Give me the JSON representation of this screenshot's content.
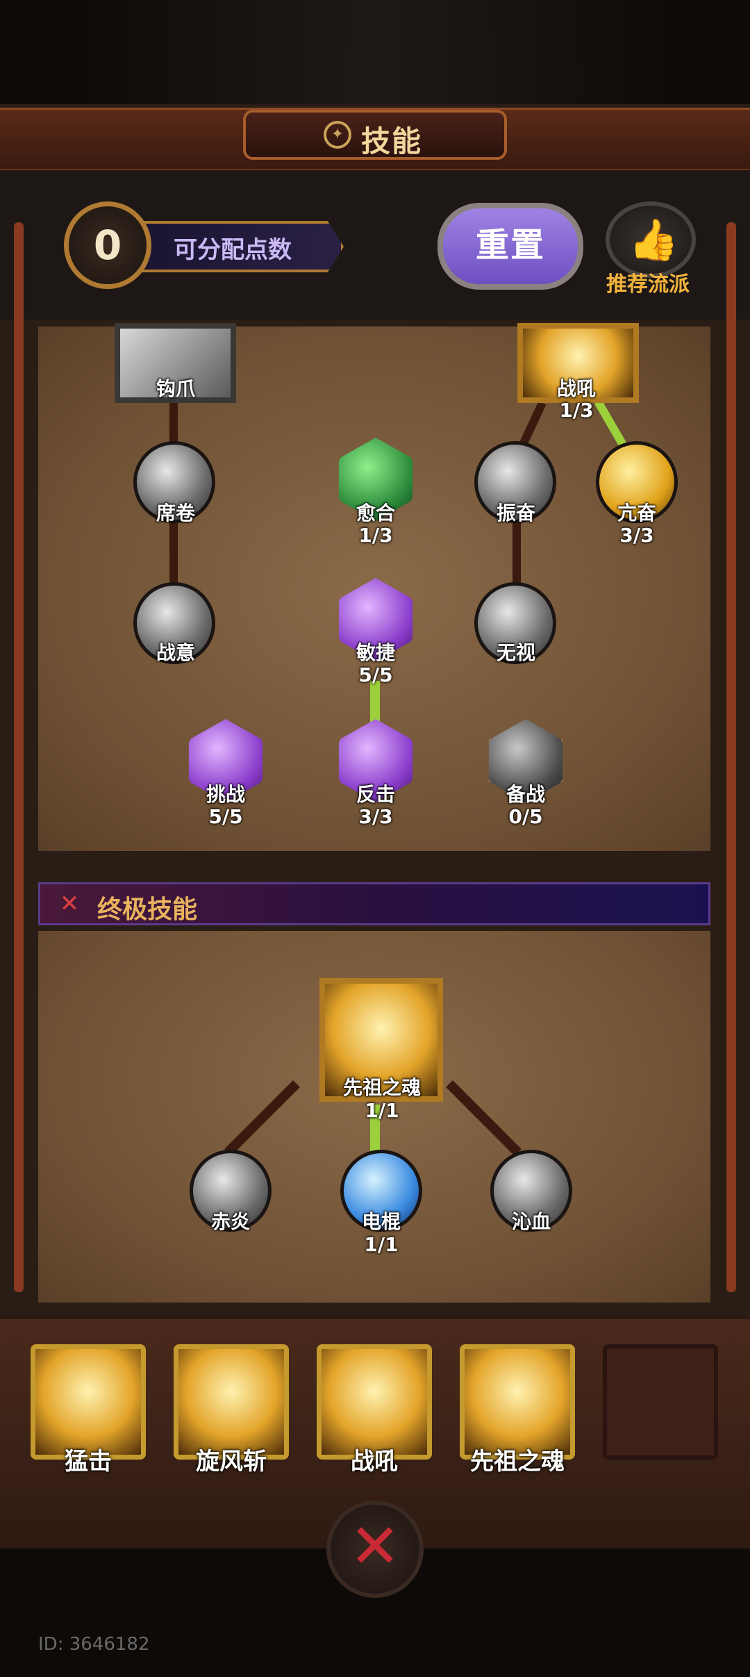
{
  "header": {
    "title": "技能"
  },
  "points": {
    "value": "0",
    "label": "可分配点数"
  },
  "buttons": {
    "reset": "重置",
    "recommend": "推荐流派"
  },
  "tree": {
    "hook": {
      "label": "钩爪"
    },
    "warcry": {
      "label": "战吼",
      "count": "1/3"
    },
    "xijuan": {
      "label": "席卷"
    },
    "yuhe": {
      "label": "愈合",
      "count": "1/3"
    },
    "zhenfen": {
      "label": "振奋"
    },
    "kangfen": {
      "label": "亢奋",
      "count": "3/3"
    },
    "zhanyi": {
      "label": "战意"
    },
    "minjie": {
      "label": "敏捷",
      "count": "5/5"
    },
    "wushi": {
      "label": "无视"
    },
    "tiaozhan": {
      "label": "挑战",
      "count": "5/5"
    },
    "fanji": {
      "label": "反击",
      "count": "3/3"
    },
    "beizhan": {
      "label": "备战",
      "count": "0/5"
    }
  },
  "ultimate": {
    "header": "终极技能",
    "ancestor": {
      "label": "先祖之魂",
      "count": "1/1"
    },
    "chiyan": {
      "label": "赤炎"
    },
    "diangun": {
      "label": "电棍",
      "count": "1/1"
    },
    "qinxue": {
      "label": "沁血"
    }
  },
  "loadout": [
    {
      "label": "猛击"
    },
    {
      "label": "旋风斩"
    },
    {
      "label": "战吼"
    },
    {
      "label": "先祖之魂"
    }
  ],
  "footer": {
    "id": "ID: 3646182"
  },
  "colors": {
    "accent_gold": "#e3a42a",
    "accent_purple": "#8a3ccb",
    "reset_button": "#7e5fd2",
    "close_red": "#c92a35"
  }
}
